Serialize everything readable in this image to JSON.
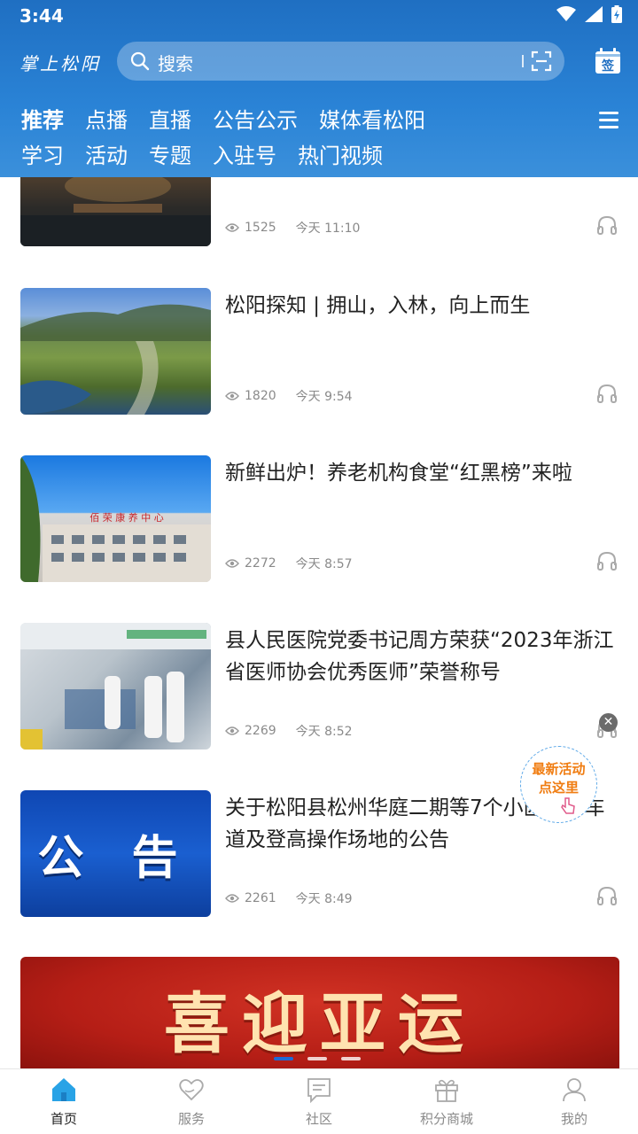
{
  "status_bar": {
    "time": "3:44"
  },
  "header": {
    "logo_text": "掌上松阳",
    "search_placeholder": "搜索",
    "sign_in_icon_label": "签"
  },
  "nav": {
    "row1": [
      "推荐",
      "点播",
      "直播",
      "公告公示",
      "媒体看松阳"
    ],
    "row2": [
      "学习",
      "活动",
      "专题",
      "入驻号",
      "热门视频"
    ],
    "active": "推荐"
  },
  "articles": [
    {
      "title": "",
      "views": "1525",
      "time": "今天 11:10"
    },
    {
      "title": "松阳探知 | 拥山，入林，向上而生",
      "views": "1820",
      "time": "今天 9:54"
    },
    {
      "title": "新鲜出炉！养老机构食堂“红黑榜”来啦",
      "views": "2272",
      "time": "今天 8:57",
      "thumb_sign": "佰 荣 康 养 中 心"
    },
    {
      "title": "县人民医院党委书记周方荣获“2023年浙江省医师协会优秀医师”荣誉称号",
      "views": "2269",
      "time": "今天 8:52"
    },
    {
      "title": "关于松阳县松州华庭二期等7个小区消防车道及登高操作场地的公告",
      "views": "2261",
      "time": "今天 8:49",
      "thumb_text": "公 告"
    }
  ],
  "banner": {
    "text": "喜迎亚运",
    "slides": 3,
    "active_slide": 1
  },
  "float_activity": {
    "line1": "最新活动",
    "line2": "点这里"
  },
  "tabbar": [
    {
      "label": "首页",
      "icon": "home-icon",
      "active": true
    },
    {
      "label": "服务",
      "icon": "heart-hand-icon",
      "active": false
    },
    {
      "label": "社区",
      "icon": "chat-icon",
      "active": false
    },
    {
      "label": "积分商城",
      "icon": "gift-icon",
      "active": false
    },
    {
      "label": "我的",
      "icon": "user-icon",
      "active": false
    }
  ],
  "colors": {
    "header_blue": "#2a83d6",
    "active_tab": "#1e6bd6",
    "float_text": "#f07d12"
  }
}
